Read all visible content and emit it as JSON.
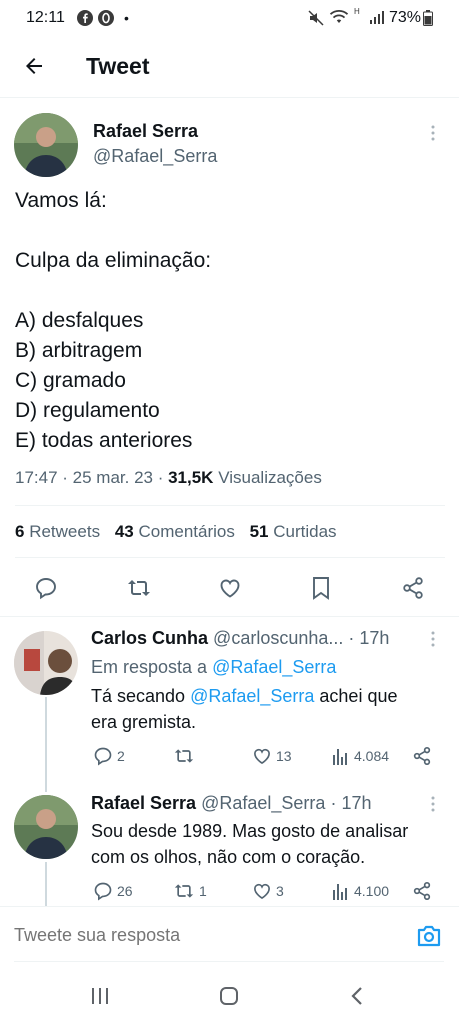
{
  "status_bar": {
    "time": "12:11",
    "battery": "73%",
    "icons": [
      "facebook-icon",
      "opera-icon",
      "dot-icon",
      "mute-icon",
      "wifi-icon",
      "signal-icon",
      "battery-icon"
    ]
  },
  "header": {
    "title": "Tweet",
    "back_icon": "arrow-left-icon"
  },
  "main_tweet": {
    "author_name": "Rafael Serra",
    "author_handle": "@Rafael_Serra",
    "text_lines": [
      "Vamos lá:",
      "",
      "Culpa da eliminação:",
      "",
      "A) desfalques",
      "B) arbitragem",
      "C) gramado",
      "D) regulamento",
      "E) todas anteriores"
    ],
    "time": "17:47",
    "date": "25 mar. 23",
    "views_count": "31,5K",
    "views_label": "Visualizações",
    "retweets_count": "6",
    "retweets_label": "Retweets",
    "comments_count": "43",
    "comments_label": "Comentários",
    "likes_count": "51",
    "likes_label": "Curtidas",
    "actions": [
      "reply-icon",
      "retweet-icon",
      "like-icon",
      "bookmark-icon",
      "share-icon"
    ]
  },
  "replies": [
    {
      "author_name": "Carlos Cunha",
      "author_handle": "@carloscunha...",
      "time": "· 17h",
      "reply_to_prefix": "Em resposta a ",
      "reply_to_handle": "@Rafael_Serra",
      "text_part1": "Tá secando ",
      "text_mention": "@Rafael_Serra",
      "text_part2": " achei que",
      "text_line2": "era gremista.",
      "replies": "2",
      "retweets": "",
      "likes": "13",
      "views": "4.084"
    },
    {
      "author_name": "Rafael Serra",
      "author_handle": "@Rafael_Serra",
      "time": "· 17h",
      "text_line1": "Sou desde 1989. Mas gosto de analisar",
      "text_line2": "com os olhos, não com o coração.",
      "replies": "26",
      "retweets": "1",
      "likes": "3",
      "views": "4.100"
    }
  ],
  "compose": {
    "placeholder": "Tweete sua resposta",
    "camera_icon": "camera-icon"
  },
  "nav_bar": {
    "icons": [
      "recent-apps-icon",
      "home-icon",
      "back-icon"
    ]
  },
  "colors": {
    "accent": "#1d9bf0",
    "text": "#0f1419",
    "muted": "#536471",
    "divider": "#eff3f4"
  }
}
